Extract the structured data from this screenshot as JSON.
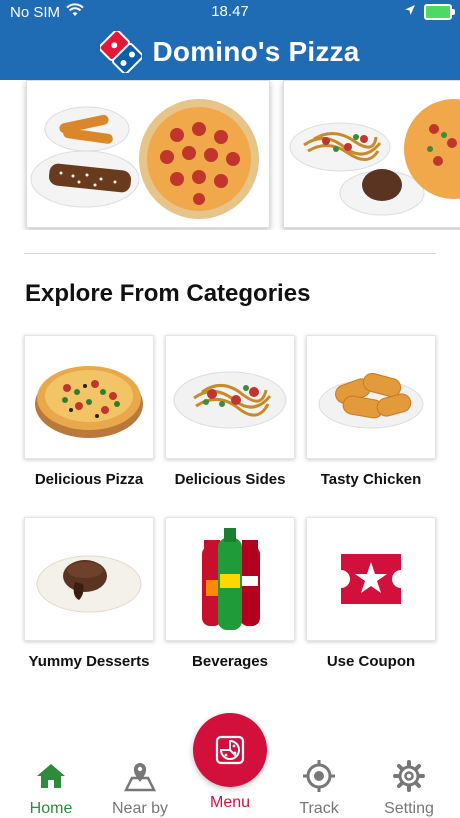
{
  "status_bar": {
    "carrier": "No SIM",
    "time": "18.47"
  },
  "header": {
    "brand": "Domino's Pizza"
  },
  "sections": {
    "categories_title": "Explore From Categories"
  },
  "categories": [
    {
      "label": "Delicious Pizza"
    },
    {
      "label": "Delicious Sides"
    },
    {
      "label": "Tasty Chicken"
    },
    {
      "label": "Yummy Desserts"
    },
    {
      "label": "Beverages"
    },
    {
      "label": "Use Coupon"
    }
  ],
  "tabbar": {
    "home": "Home",
    "nearby": "Near by",
    "menu": "Menu",
    "track": "Track",
    "setting": "Setting"
  },
  "colors": {
    "brand_blue": "#1f6cb5",
    "accent_red": "#d3103c",
    "active_green": "#2e8b3c"
  }
}
